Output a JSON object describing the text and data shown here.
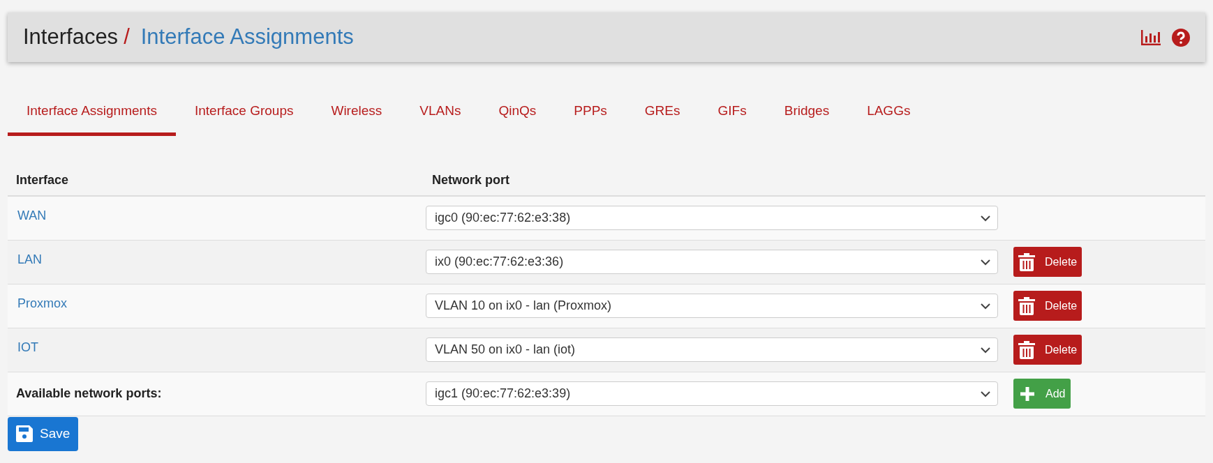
{
  "breadcrumb": {
    "parent": "Interfaces",
    "separator": "/",
    "current": "Interface Assignments"
  },
  "tabs": [
    {
      "label": "Interface Assignments",
      "selected": true
    },
    {
      "label": "Interface Groups",
      "selected": false
    },
    {
      "label": "Wireless",
      "selected": false
    },
    {
      "label": "VLANs",
      "selected": false
    },
    {
      "label": "QinQs",
      "selected": false
    },
    {
      "label": "PPPs",
      "selected": false
    },
    {
      "label": "GREs",
      "selected": false
    },
    {
      "label": "GIFs",
      "selected": false
    },
    {
      "label": "Bridges",
      "selected": false
    },
    {
      "label": "LAGGs",
      "selected": false
    }
  ],
  "table": {
    "columns": [
      "Interface",
      "Network port"
    ],
    "rows": [
      {
        "interface": "WAN",
        "port": "igc0 (90:ec:77:62:e3:38)"
      },
      {
        "interface": "LAN",
        "port": "ix0 (90:ec:77:62:e3:36)",
        "action": "Delete"
      },
      {
        "interface": "Proxmox",
        "port": "VLAN 10 on ix0 - lan (Proxmox)",
        "action": "Delete"
      },
      {
        "interface": "IOT",
        "port": "VLAN 50 on ix0 - lan (iot)",
        "action": "Delete"
      }
    ],
    "available": {
      "label": "Available network ports:",
      "port": "igc1 (90:ec:77:62:e3:39)",
      "action": "Add"
    }
  },
  "save_button": "Save"
}
